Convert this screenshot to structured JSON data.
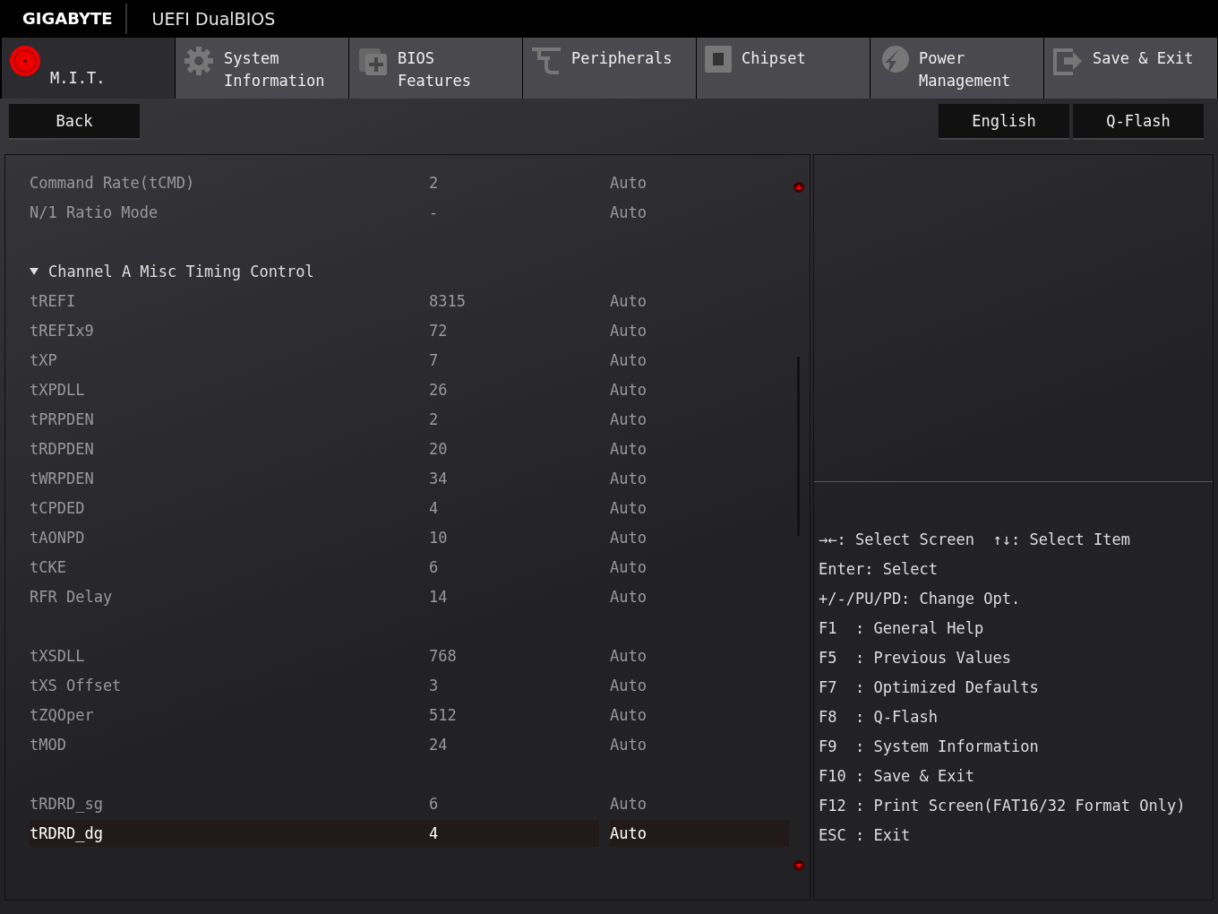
{
  "header": {
    "brand": "GIGABYTE",
    "title": "UEFI DualBIOS"
  },
  "tabs": [
    {
      "label": "M.I.T.",
      "selected": true
    },
    {
      "label": "System\nInformation",
      "selected": false
    },
    {
      "label": "BIOS\nFeatures",
      "selected": false
    },
    {
      "label": "Peripherals",
      "selected": false
    },
    {
      "label": "Chipset",
      "selected": false
    },
    {
      "label": "Power\nManagement",
      "selected": false
    },
    {
      "label": "Save & Exit",
      "selected": false
    }
  ],
  "back_button": "Back",
  "right_buttons": [
    "English",
    "Q-Flash"
  ],
  "rows": [
    {
      "kind": "setting",
      "name": "Command Rate(tCMD)",
      "value": "2",
      "option": "Auto",
      "selected": false
    },
    {
      "kind": "setting",
      "name": "N/1 Ratio Mode",
      "value": "-",
      "option": "Auto",
      "selected": false
    },
    {
      "kind": "gap"
    },
    {
      "kind": "section",
      "name": "Channel A Misc Timing Control",
      "expanded": true
    },
    {
      "kind": "setting",
      "name": "tREFI",
      "value": "8315",
      "option": "Auto",
      "selected": false
    },
    {
      "kind": "setting",
      "name": "tREFIx9",
      "value": "72",
      "option": "Auto",
      "selected": false
    },
    {
      "kind": "setting",
      "name": "tXP",
      "value": "7",
      "option": "Auto",
      "selected": false
    },
    {
      "kind": "setting",
      "name": "tXPDLL",
      "value": "26",
      "option": "Auto",
      "selected": false
    },
    {
      "kind": "setting",
      "name": "tPRPDEN",
      "value": "2",
      "option": "Auto",
      "selected": false
    },
    {
      "kind": "setting",
      "name": "tRDPDEN",
      "value": "20",
      "option": "Auto",
      "selected": false
    },
    {
      "kind": "setting",
      "name": "tWRPDEN",
      "value": "34",
      "option": "Auto",
      "selected": false
    },
    {
      "kind": "setting",
      "name": "tCPDED",
      "value": "4",
      "option": "Auto",
      "selected": false
    },
    {
      "kind": "setting",
      "name": "tAONPD",
      "value": "10",
      "option": "Auto",
      "selected": false
    },
    {
      "kind": "setting",
      "name": "tCKE",
      "value": "6",
      "option": "Auto",
      "selected": false
    },
    {
      "kind": "setting",
      "name": "RFR Delay",
      "value": "14",
      "option": "Auto",
      "selected": false
    },
    {
      "kind": "gap"
    },
    {
      "kind": "setting",
      "name": "tXSDLL",
      "value": "768",
      "option": "Auto",
      "selected": false
    },
    {
      "kind": "setting",
      "name": "tXS Offset",
      "value": "3",
      "option": "Auto",
      "selected": false
    },
    {
      "kind": "setting",
      "name": "tZQOper",
      "value": "512",
      "option": "Auto",
      "selected": false
    },
    {
      "kind": "setting",
      "name": "tMOD",
      "value": "24",
      "option": "Auto",
      "selected": false
    },
    {
      "kind": "gap"
    },
    {
      "kind": "setting",
      "name": "tRDRD_sg",
      "value": "6",
      "option": "Auto",
      "selected": false
    },
    {
      "kind": "setting",
      "name": "tRDRD_dg",
      "value": "4",
      "option": "Auto",
      "selected": true
    }
  ],
  "help": [
    "→←: Select Screen  ↑↓: Select Item",
    "Enter: Select",
    "+/-/PU/PD: Change Opt.",
    "F1  : General Help",
    "F5  : Previous Values",
    "F7  : Optimized Defaults",
    "F8  : Q-Flash",
    "F9  : System Information",
    "F10 : Save & Exit",
    "F12 : Print Screen(FAT16/32 Format Only)",
    "ESC : Exit"
  ]
}
